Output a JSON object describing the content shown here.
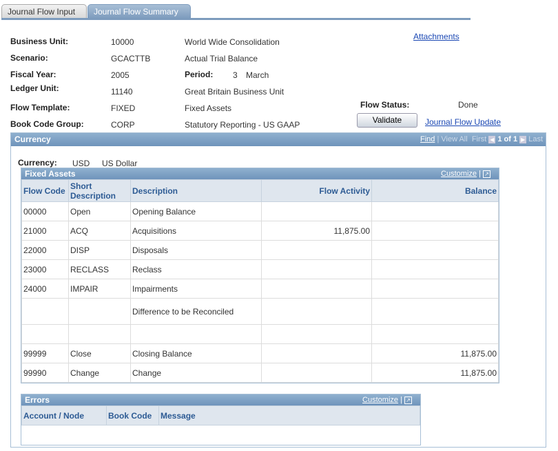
{
  "tabs": [
    {
      "label": "Journal Flow Input",
      "active": false
    },
    {
      "label": "Journal Flow Summary",
      "active": true
    }
  ],
  "header": {
    "attachments": "Attachments",
    "business_unit": {
      "label": "Business Unit:",
      "value": "10000",
      "desc": "World Wide Consolidation"
    },
    "scenario": {
      "label": "Scenario:",
      "value": "GCACTTB",
      "desc": "Actual Trial Balance"
    },
    "fiscal_year": {
      "label": "Fiscal Year:",
      "value": "2005"
    },
    "period": {
      "label": "Period:",
      "value": "3",
      "desc": "March"
    },
    "ledger_unit": {
      "label": "Ledger Unit:",
      "value": "11140",
      "desc": "Great Britain Business Unit"
    },
    "flow_template": {
      "label": "Flow Template:",
      "value": "FIXED",
      "desc": "Fixed Assets"
    },
    "book_code_group": {
      "label": "Book Code Group:",
      "value": "CORP",
      "desc": "Statutory Reporting - US GAAP"
    },
    "flow_status": {
      "label": "Flow Status:",
      "value": "Done"
    },
    "validate": "Validate",
    "journal_flow_update": "Journal Flow Update"
  },
  "currency_panel": {
    "title": "Currency",
    "find": "Find",
    "view_all": "View All",
    "first": "First",
    "count": "1 of 1",
    "last": "Last",
    "currency_label": "Currency:",
    "currency_code": "USD",
    "currency_desc": "US Dollar"
  },
  "fixed_assets": {
    "title": "Fixed Assets",
    "customize": "Customize",
    "columns": [
      "Flow Code",
      "Short Description",
      "Description",
      "Flow Activity",
      "Balance"
    ],
    "rows": [
      [
        "00000",
        "Open",
        "Opening Balance",
        "",
        ""
      ],
      [
        "21000",
        "ACQ",
        "Acquisitions",
        "11,875.00",
        ""
      ],
      [
        "22000",
        "DISP",
        "Disposals",
        "",
        ""
      ],
      [
        "23000",
        "RECLASS",
        "Reclass",
        "",
        ""
      ],
      [
        "24000",
        "IMPAIR",
        "Impairments",
        "",
        ""
      ],
      [
        "",
        "",
        "Difference to be Reconciled",
        "",
        ""
      ],
      [
        "",
        "",
        "",
        "",
        ""
      ],
      [
        "99999",
        "Close",
        "Closing Balance",
        "",
        "11,875.00"
      ],
      [
        "99990",
        "Change",
        "Change",
        "",
        "11,875.00"
      ]
    ]
  },
  "errors": {
    "title": "Errors",
    "customize": "Customize",
    "columns": [
      "Account / Node",
      "Book Code",
      "Message"
    ]
  }
}
